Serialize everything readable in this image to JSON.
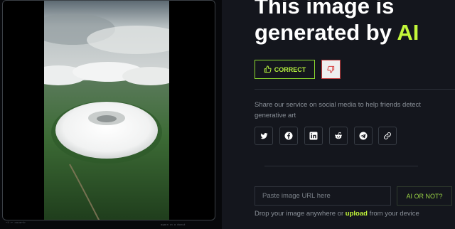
{
  "headline": {
    "line1": "This image is",
    "line2_prefix": "generated by ",
    "accent": "AI"
  },
  "feedback": {
    "correct_label": "CORRECT"
  },
  "share": {
    "text": "Share our service on social media to help friends detect generative art",
    "icons": [
      "twitter-icon",
      "facebook-icon",
      "linkedin-icon",
      "reddit-icon",
      "telegram-icon",
      "link-icon"
    ]
  },
  "url_input": {
    "placeholder": "Paste image URL here",
    "value": ""
  },
  "submit": {
    "label": "AI OR NOT?"
  },
  "drop": {
    "prefix": "Drop your image anywhere or ",
    "link": "upload",
    "suffix": " from your device"
  },
  "colors": {
    "accent": "#c3f73a",
    "background": "#14161d",
    "danger": "#c43a3a"
  }
}
